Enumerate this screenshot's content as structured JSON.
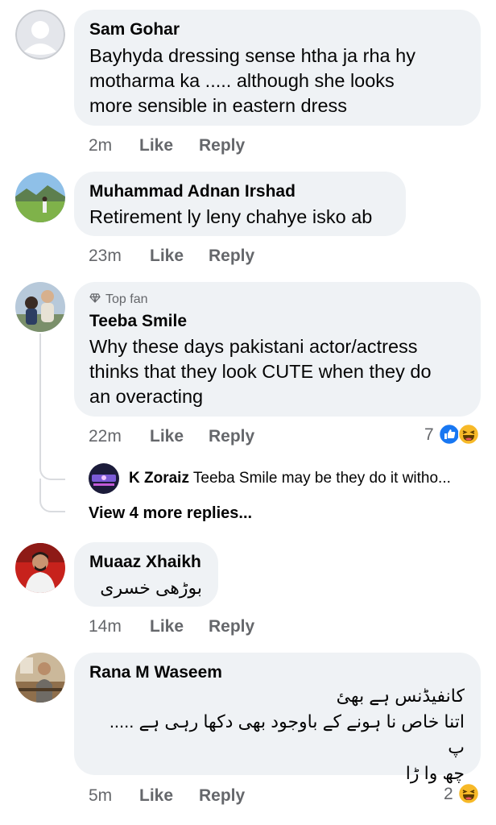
{
  "comments": [
    {
      "author": "Sam Gohar",
      "lines": [
        "Bayhyda dressing sense htha ja rha hy",
        "motharma ka ..... although she looks",
        "more sensible in eastern dress"
      ],
      "time": "2m",
      "like": "Like",
      "reply": "Reply"
    },
    {
      "author": "Muhammad Adnan Irshad",
      "lines": [
        "Retirement ly leny chahye isko ab"
      ],
      "time": "23m",
      "like": "Like",
      "reply": "Reply"
    },
    {
      "badge": "Top fan",
      "author": "Teeba Smile",
      "lines": [
        "Why these days pakistani actor/actress",
        "thinks that they look CUTE when they do",
        "an overacting"
      ],
      "time": "22m",
      "like": "Like",
      "reply": "Reply",
      "reaction_count": "7",
      "reaction_icons": [
        "like-reaction",
        "haha-reaction"
      ],
      "reply_preview": {
        "author": "K Zoraiz",
        "text": "Teeba Smile may be they do it witho..."
      },
      "more_replies": "View 4 more replies..."
    },
    {
      "author": "Muaaz Xhaikh",
      "lines": [
        "بوڑھی خسری"
      ],
      "time": "14m",
      "like": "Like",
      "reply": "Reply"
    },
    {
      "author": "Rana M Waseem",
      "lines": [
        "کانفیڈنس ہے بھئ",
        "اتنا خاص نا ہونے کے باوجود بھی دکھا رہی ہے ..... پ",
        "چھ وا ڑا"
      ],
      "time": "5m",
      "like": "Like",
      "reply": "Reply",
      "reaction_count": "2",
      "reaction_icons": [
        "haha-reaction"
      ]
    }
  ],
  "colors": {
    "bubble": "#eff2f5",
    "meta": "#65676b",
    "like_blue": "#1877f2",
    "haha_yellow": "#f7b928"
  }
}
